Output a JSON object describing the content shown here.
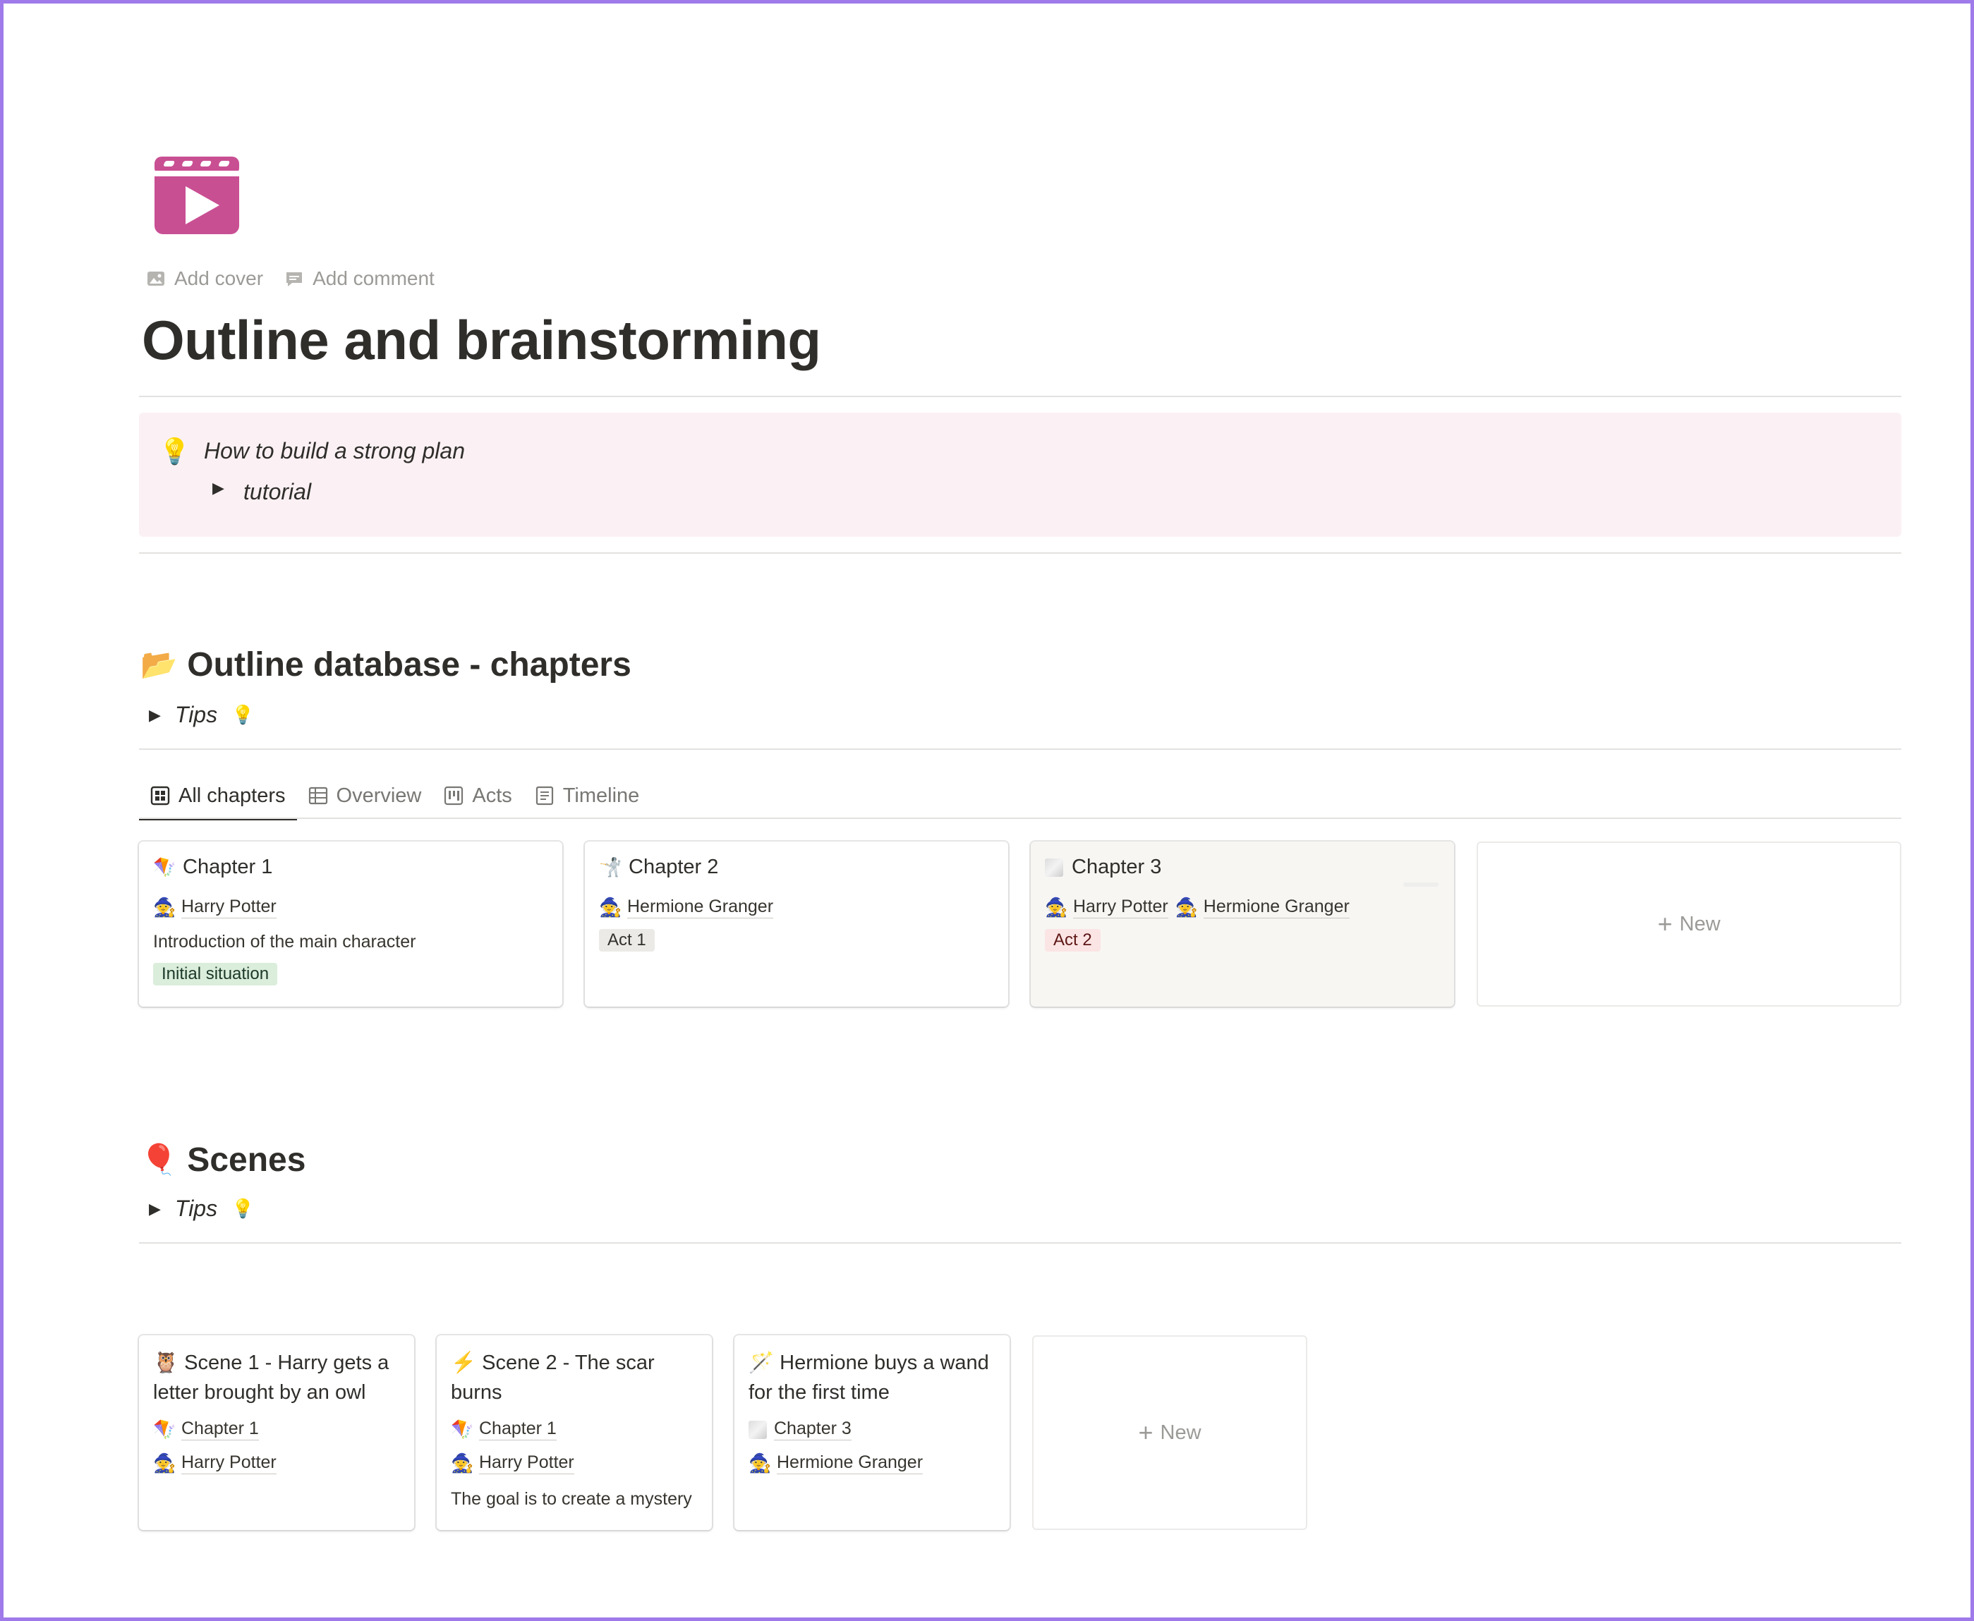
{
  "page": {
    "icon": "clapperboard-icon",
    "add_cover": "Add cover",
    "add_comment": "Add comment",
    "title": "Outline and brainstorming"
  },
  "callout": {
    "icon": "💡",
    "title": "How to build a strong plan",
    "toggle_label": "tutorial"
  },
  "chapters_section": {
    "emoji": "📂",
    "title": "Outline database - chapters",
    "tips_label": "Tips",
    "tips_emoji": "💡",
    "tabs": [
      {
        "label": "All chapters",
        "icon": "gallery-icon"
      },
      {
        "label": "Overview",
        "icon": "table-icon"
      },
      {
        "label": "Acts",
        "icon": "board-icon"
      },
      {
        "label": "Timeline",
        "icon": "list-icon"
      }
    ],
    "cards": [
      {
        "emoji": "🪁",
        "title": "Chapter 1",
        "characters": [
          {
            "emoji": "🧙",
            "name": "Harry Potter"
          }
        ],
        "description": "Introduction of the main character",
        "tag": "Initial situation"
      },
      {
        "emoji": "🤺",
        "title": "Chapter 2",
        "characters": [
          {
            "emoji": "🧙",
            "name": "Hermione Granger"
          }
        ],
        "tag": "Act 1"
      },
      {
        "emoji": "",
        "title": "Chapter 3",
        "characters": [
          {
            "emoji": "🧙",
            "name": "Harry Potter"
          },
          {
            "emoji": "🧙",
            "name": "Hermione Granger"
          }
        ],
        "tag": "Act 2"
      }
    ],
    "new_label": "New"
  },
  "scenes_section": {
    "emoji": "🎈",
    "title": "Scenes",
    "tips_label": "Tips",
    "tips_emoji": "💡",
    "cards": [
      {
        "emoji": "🦉",
        "title": "Scene 1 - Harry gets a letter brought by an owl",
        "chapter_emoji": "🪁",
        "chapter": "Chapter 1",
        "character_emoji": "🧙",
        "character": "Harry Potter"
      },
      {
        "emoji": "⚡",
        "title": "Scene 2 - The scar burns",
        "chapter_emoji": "🪁",
        "chapter": "Chapter 1",
        "character_emoji": "🧙",
        "character": "Harry Potter",
        "description": "The goal is to create a mystery"
      },
      {
        "emoji": "🪄",
        "title": "Hermione buys a wand for the first time",
        "chapter_emoji": "",
        "chapter": "Chapter 3",
        "character_emoji": "🧙",
        "character": "Hermione Granger"
      }
    ],
    "new_label": "New"
  }
}
